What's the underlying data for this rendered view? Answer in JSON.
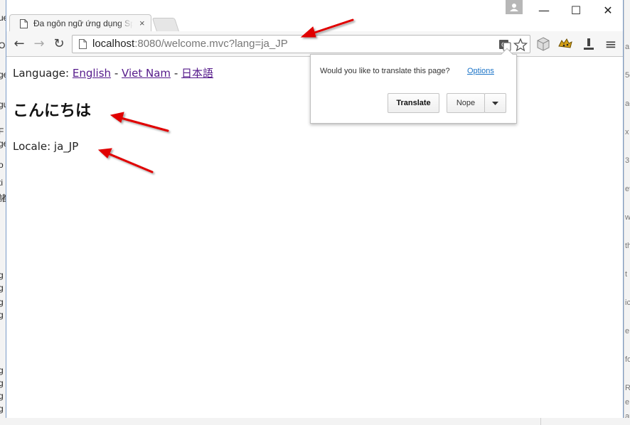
{
  "browser": {
    "tab_title": "Đa ngôn ngữ ứng dụng Sp",
    "tab_close": "×",
    "url_host": "localhost",
    "url_rest": ":8080/welcome.mvc?lang=ja_JP",
    "window_controls": {
      "minimize": "—",
      "maximize": "☐",
      "close": "✕"
    },
    "nav": {
      "back": "←",
      "forward": "→",
      "reload": "↻",
      "menu": "≡"
    }
  },
  "page": {
    "language_label": "Language:",
    "links": [
      "English",
      "Viet Nam",
      "日本語"
    ],
    "separator": "-",
    "greeting": "こんにちは",
    "locale_text": "Locale: ja_JP"
  },
  "translate_popup": {
    "question": "Would you like to translate this page?",
    "options_label": "Options",
    "translate_label": "Translate",
    "nope_label": "Nope"
  },
  "background_fragments": {
    "left": [
      "ue",
      "ON",
      "ge",
      "gu",
      "F",
      "ge",
      "o",
      "ti",
      "諸",
      "g",
      "g",
      "g",
      "g",
      "g",
      "g",
      "g",
      "g"
    ],
    "right": [
      "a",
      "5c",
      "ac",
      "x",
      "3",
      "et",
      "w",
      "th",
      "t",
      "ic",
      "e",
      "fo",
      "R",
      "e",
      "ar"
    ]
  },
  "colors": {
    "link_visited": "#551a8b",
    "options_link": "#1a73c7",
    "annotation_arrow": "#e00000",
    "window_border": "#7a9ac7"
  }
}
